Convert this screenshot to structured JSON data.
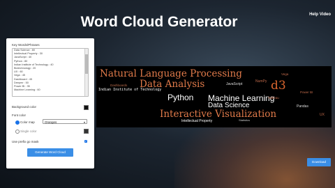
{
  "header": {
    "title": "Word Cloud Generator",
    "help_link": "Help Video"
  },
  "panel": {
    "words_label": "Key Words/Phrases",
    "words": [
      "Data Science : 80",
      "Intellectual Property : 30",
      "JavaScript : 40",
      "Python : 80",
      "Indian Institute of Technology : 40",
      "Biotechnology : 20",
      "UX : 60",
      "Vega : 45",
      "Dashboard : 45",
      "Deepmr : 50",
      "Power BI : 35",
      "Machine Learning : 60"
    ],
    "bg_color_label": "Background color",
    "bg_color": "#111111",
    "font_color_label": "Font color",
    "color_map_label": "Color map",
    "color_map_value": "Oranges",
    "single_color_label": "Single color",
    "single_color": "#333333",
    "use_prefix_label": "Use prefix go mask",
    "generate_button": "Generate Word Cloud"
  },
  "cloud": {
    "words": [
      {
        "text": "Natural Language Processing",
        "color": "#e07a4a"
      },
      {
        "text": "Data Analysis",
        "color": "#e07a4a"
      },
      {
        "text": "d3",
        "color": "#d9652e"
      },
      {
        "text": "Python",
        "color": "#ffffff"
      },
      {
        "text": "Machine Learning",
        "color": "#ffffff"
      },
      {
        "text": "Data Science",
        "color": "#ffffff"
      },
      {
        "text": "Interactive Visualization",
        "color": "#e07a4a"
      },
      {
        "text": "Indian Institute of Technology",
        "color": "#ffffff"
      },
      {
        "text": "Intellectual Property",
        "color": "#ffffff"
      },
      {
        "text": "JavaScript",
        "color": "#dddddd"
      },
      {
        "text": "Dashboards",
        "color": "#b86a4a"
      },
      {
        "text": "NumPy",
        "color": "#c06a4a"
      },
      {
        "text": "Pandas",
        "color": "#dddddd"
      },
      {
        "text": "Vega",
        "color": "#c06a4a"
      },
      {
        "text": "Statistics",
        "color": "#cccccc"
      },
      {
        "text": "UX",
        "color": "#c06a4a"
      },
      {
        "text": "Power BI",
        "color": "#c06a4a"
      },
      {
        "text": "Tableau",
        "color": "#c06a4a"
      }
    ]
  },
  "download_button": "Download"
}
